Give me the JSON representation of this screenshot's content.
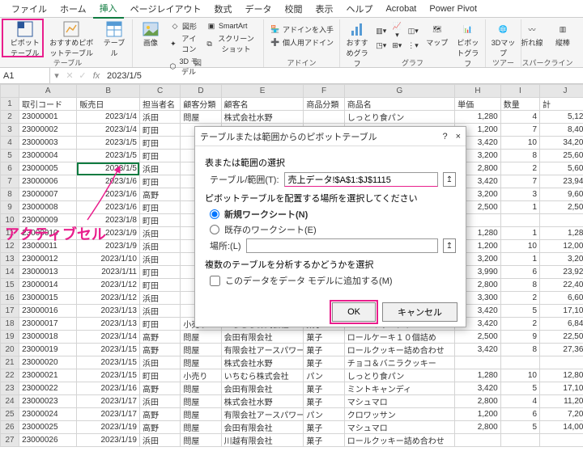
{
  "tabs": [
    "ファイル",
    "ホーム",
    "挿入",
    "ページレイアウト",
    "数式",
    "データ",
    "校閲",
    "表示",
    "ヘルプ",
    "Acrobat",
    "Power Pivot"
  ],
  "active_tab": 2,
  "ribbon": {
    "pivot_table": "ピボットテーブル",
    "recommended_pivot": "おすすめピボットテーブル",
    "table": "テーブル",
    "group_tables": "テーブル",
    "image": "画像",
    "shapes": "図形",
    "icons": "アイコン",
    "model3d": "3D モデル",
    "smartart": "SmartArt",
    "screenshot": "スクリーンショット",
    "group_illust": "図",
    "addins_get": "アドインを入手",
    "addins_my": "個人用アドイン",
    "group_addins": "アドイン",
    "recommended_chart": "おすすめグラフ",
    "maps": "マップ",
    "pivotchart": "ピボットグラフ",
    "group_charts": "グラフ",
    "map3d": "3Dマップ",
    "group_tour": "ツアー",
    "line": "折れ線",
    "column": "縦棒",
    "group_spark": "スパークライン"
  },
  "name_box": "A1",
  "formula": "2023/1/5",
  "headers": [
    "",
    "A",
    "B",
    "C",
    "D",
    "E",
    "F",
    "G",
    "H",
    "I",
    "J"
  ],
  "header_row": {
    "A": "取引コード",
    "B": "販売日",
    "C": "担当者名",
    "D": "顧客分類",
    "E": "顧客名",
    "F": "商品分類",
    "G": "商品名",
    "H": "単価",
    "I": "数量",
    "J": "計"
  },
  "rows": [
    {
      "n": 2,
      "A": "23000001",
      "B": "2023/1/4",
      "C": "浜田",
      "D": "問屋",
      "E": "株式会社水野",
      "F": "",
      "G": "しっとり食パン",
      "H": "1,280",
      "I": "4",
      "J": "5,120"
    },
    {
      "n": 3,
      "A": "23000002",
      "B": "2023/1/4",
      "C": "町田",
      "D": "",
      "E": "",
      "F": "",
      "G": "",
      "H": "1,200",
      "I": "7",
      "J": "8,400"
    },
    {
      "n": 4,
      "A": "23000003",
      "B": "2023/1/5",
      "C": "町田",
      "D": "",
      "E": "",
      "F": "",
      "G": "",
      "H": "3,420",
      "I": "10",
      "J": "34,200"
    },
    {
      "n": 5,
      "A": "23000004",
      "B": "2023/1/5",
      "C": "町田",
      "D": "",
      "E": "",
      "F": "",
      "G": "",
      "H": "3,200",
      "I": "8",
      "J": "25,600"
    },
    {
      "n": 6,
      "A": "23000005",
      "B": "2023/1/5",
      "C": "浜田",
      "D": "",
      "E": "",
      "F": "",
      "G": "",
      "H": "2,800",
      "I": "2",
      "J": "5,600"
    },
    {
      "n": 7,
      "A": "23000006",
      "B": "2023/1/6",
      "C": "町田",
      "D": "",
      "E": "",
      "F": "",
      "G": "",
      "H": "3,420",
      "I": "7",
      "J": "23,940"
    },
    {
      "n": 8,
      "A": "23000007",
      "B": "2023/1/6",
      "C": "高野",
      "D": "",
      "E": "",
      "F": "",
      "G": "",
      "H": "3,200",
      "I": "3",
      "J": "9,600"
    },
    {
      "n": 9,
      "A": "23000008",
      "B": "2023/1/6",
      "C": "町田",
      "D": "",
      "E": "",
      "F": "",
      "G": "",
      "H": "2,500",
      "I": "1",
      "J": "2,500"
    },
    {
      "n": 10,
      "A": "23000009",
      "B": "2023/1/8",
      "C": "町田",
      "D": "",
      "E": "",
      "F": "",
      "G": "",
      "H": "",
      "I": "",
      "J": ""
    },
    {
      "n": 11,
      "A": "23000010",
      "B": "2023/1/9",
      "C": "浜田",
      "D": "",
      "E": "",
      "F": "",
      "G": "",
      "H": "1,280",
      "I": "1",
      "J": "1,280"
    },
    {
      "n": 12,
      "A": "23000011",
      "B": "2023/1/9",
      "C": "浜田",
      "D": "",
      "E": "",
      "F": "",
      "G": "",
      "H": "1,200",
      "I": "10",
      "J": "12,000"
    },
    {
      "n": 13,
      "A": "23000012",
      "B": "2023/1/10",
      "C": "浜田",
      "D": "",
      "E": "",
      "F": "",
      "G": "",
      "H": "3,200",
      "I": "1",
      "J": "3,200"
    },
    {
      "n": 14,
      "A": "23000013",
      "B": "2023/1/11",
      "C": "町田",
      "D": "",
      "E": "",
      "F": "",
      "G": "",
      "H": "3,990",
      "I": "6",
      "J": "23,920"
    },
    {
      "n": 15,
      "A": "23000014",
      "B": "2023/1/12",
      "C": "町田",
      "D": "",
      "E": "",
      "F": "",
      "G": "",
      "H": "2,800",
      "I": "8",
      "J": "22,400"
    },
    {
      "n": 16,
      "A": "23000015",
      "B": "2023/1/12",
      "C": "浜田",
      "D": "",
      "E": "",
      "F": "",
      "G": "",
      "H": "3,300",
      "I": "2",
      "J": "6,600"
    },
    {
      "n": 17,
      "A": "23000016",
      "B": "2023/1/13",
      "C": "浜田",
      "D": "",
      "E": "",
      "F": "",
      "G": "",
      "H": "3,420",
      "I": "5",
      "J": "17,100"
    },
    {
      "n": 18,
      "A": "23000017",
      "B": "2023/1/13",
      "C": "町田",
      "D": "小売り",
      "E": "いちむら株式会社",
      "F": "菓子",
      "G": "ミントキャンディ",
      "H": "3,420",
      "I": "2",
      "J": "6,840"
    },
    {
      "n": 19,
      "A": "23000018",
      "B": "2023/1/14",
      "C": "高野",
      "D": "問屋",
      "E": "会田有限会社",
      "F": "菓子",
      "G": "ロールケーキ１０個詰め",
      "H": "2,500",
      "I": "9",
      "J": "22,500"
    },
    {
      "n": 20,
      "A": "23000019",
      "B": "2023/1/15",
      "C": "高野",
      "D": "問屋",
      "E": "有限会社アースパワー",
      "F": "菓子",
      "G": "ロールクッキー詰め合わせ",
      "H": "3,420",
      "I": "8",
      "J": "27,360"
    },
    {
      "n": 21,
      "A": "23000020",
      "B": "2023/1/15",
      "C": "浜田",
      "D": "問屋",
      "E": "株式会社水野",
      "F": "菓子",
      "G": "チョコ＆バニラクッキー",
      "H": "",
      "I": "",
      "J": ""
    },
    {
      "n": 22,
      "A": "23000021",
      "B": "2023/1/15",
      "C": "町田",
      "D": "小売り",
      "E": "いちむら株式会社",
      "F": "パン",
      "G": "しっとり食パン",
      "H": "1,280",
      "I": "10",
      "J": "12,800"
    },
    {
      "n": 23,
      "A": "23000022",
      "B": "2023/1/16",
      "C": "高野",
      "D": "問屋",
      "E": "会田有限会社",
      "F": "菓子",
      "G": "ミントキャンディ",
      "H": "3,420",
      "I": "5",
      "J": "17,100"
    },
    {
      "n": 24,
      "A": "23000023",
      "B": "2023/1/17",
      "C": "浜田",
      "D": "問屋",
      "E": "株式会社水野",
      "F": "菓子",
      "G": "マシュマロ",
      "H": "2,800",
      "I": "4",
      "J": "11,200"
    },
    {
      "n": 25,
      "A": "23000024",
      "B": "2023/1/17",
      "C": "高野",
      "D": "問屋",
      "E": "有限会社アースパワー",
      "F": "パン",
      "G": "クロワッサン",
      "H": "1,200",
      "I": "6",
      "J": "7,200"
    },
    {
      "n": 26,
      "A": "23000025",
      "B": "2023/1/19",
      "C": "高野",
      "D": "問屋",
      "E": "会田有限会社",
      "F": "菓子",
      "G": "マシュマロ",
      "H": "2,800",
      "I": "5",
      "J": "14,000"
    },
    {
      "n": 27,
      "A": "23000026",
      "B": "2023/1/19",
      "C": "浜田",
      "D": "問屋",
      "E": "川越有限会社",
      "F": "菓子",
      "G": "ロールクッキー詰め合わせ",
      "H": "",
      "I": "",
      "J": ""
    }
  ],
  "annotation": "アクティブセル",
  "dialog": {
    "title": "テーブルまたは範囲からのピボットテーブル",
    "help": "?",
    "close": "×",
    "sec1": "表または範囲の選択",
    "range_label": "テーブル/範囲(T):",
    "range_value": "売上データ!$A$1:$J$1115",
    "sec2": "ピボットテーブルを配置する場所を選択してください",
    "opt_new": "新規ワークシート(N)",
    "opt_existing": "既存のワークシート(E)",
    "location_label": "場所:(L)",
    "location_value": "",
    "sec3": "複数のテーブルを分析するかどうかを選択",
    "chk_model": "このデータをデータ モデルに追加する(M)",
    "ok": "OK",
    "cancel": "キャンセル"
  }
}
